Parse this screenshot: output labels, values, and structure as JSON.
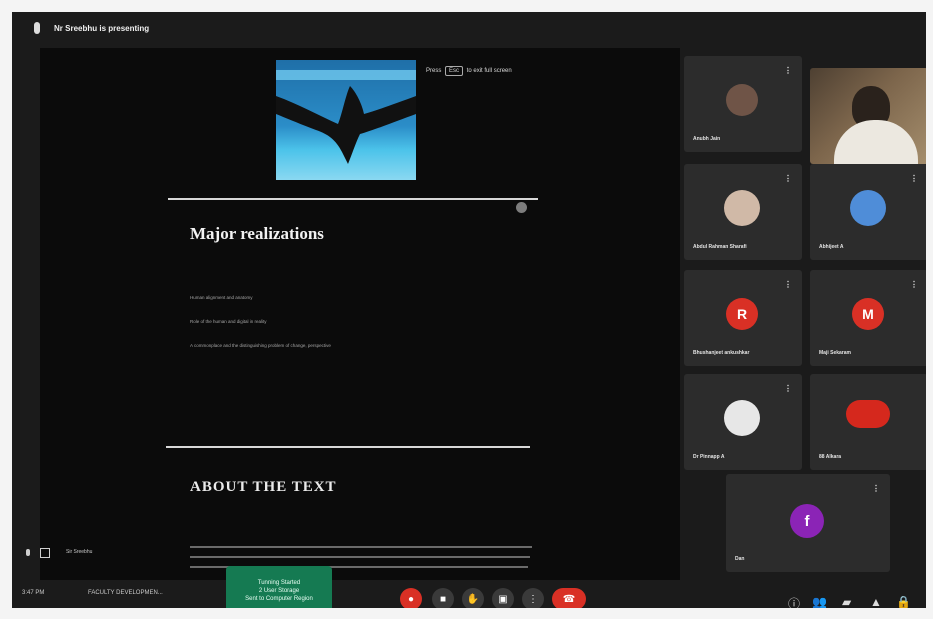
{
  "meet": {
    "presenting_label": "Nr Sreebhu is presenting",
    "escape_hint_pre": "Press",
    "escape_key": "Esc",
    "escape_hint_post": "to exit full screen"
  },
  "slide": {
    "heading": "Major realizations",
    "bullets": [
      "Human alignment and anatomy",
      "Role of the human and digital in reality",
      "A commonplace and the distinguishing problem of change, perspective"
    ],
    "section": "ABOUT THE TEXT"
  },
  "participants": [
    {
      "name": "Anubh Jain",
      "initial": "",
      "color": "#6f5447"
    },
    {
      "name": "Abdul Rahman Sharafi",
      "initial": "",
      "color": "#d0b9a7"
    },
    {
      "name": "Abhijeet A",
      "initial": "",
      "color": "#4f8dd8"
    },
    {
      "name": "Bhushanjeet ankushkar",
      "initial": "R",
      "color": "#d93025"
    },
    {
      "name": "Maji Sekaram",
      "initial": "M",
      "color": "#d93025"
    },
    {
      "name": "Dr Pinnapp A",
      "initial": "",
      "color": "#e7e7e7"
    },
    {
      "name": "88 Alkara",
      "initial": "",
      "color": "#d5281d"
    },
    {
      "name": "Dan",
      "initial": "f",
      "color": "#8b24b6"
    }
  ],
  "side_controls": {
    "label": "Sir Sreebhu"
  },
  "bottom": {
    "time": "3:47 PM",
    "meeting": "FACULTY DEVELOPMEN...",
    "notice": [
      "Tunning Started",
      "2 User Storage",
      "Sent to Computer Region"
    ]
  }
}
